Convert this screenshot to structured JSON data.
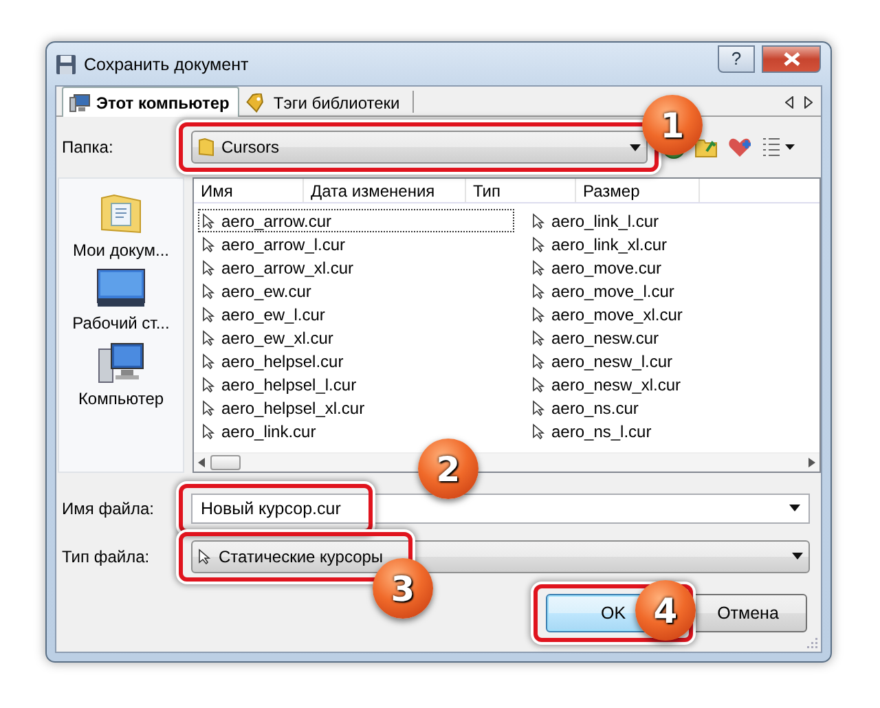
{
  "window": {
    "title": "Сохранить документ",
    "help": "?"
  },
  "tabs": [
    {
      "label": "Этот компьютер",
      "selected": true,
      "kind": "computer"
    },
    {
      "label": "Тэги библиотеки",
      "selected": false,
      "kind": "tag"
    }
  ],
  "folder": {
    "label": "Папка:",
    "value": "Cursors",
    "highlighted": true,
    "badge": "1"
  },
  "places": [
    {
      "label": "Мои докум...",
      "kind": "documents"
    },
    {
      "label": "Рабочий ст...",
      "kind": "desktop"
    },
    {
      "label": "Компьютер",
      "kind": "computer"
    }
  ],
  "columns": [
    "Имя",
    "Дата изменения",
    "Тип",
    "Размер"
  ],
  "files": [
    {
      "name": "aero_arrow.cur",
      "focused": true
    },
    {
      "name": "aero_arrow_l.cur",
      "focused": false
    },
    {
      "name": "aero_arrow_xl.cur",
      "focused": false
    },
    {
      "name": "aero_ew.cur",
      "focused": false
    },
    {
      "name": "aero_ew_l.cur",
      "focused": false
    },
    {
      "name": "aero_ew_xl.cur",
      "focused": false
    },
    {
      "name": "aero_helpsel.cur",
      "focused": false
    },
    {
      "name": "aero_helpsel_l.cur",
      "focused": false
    },
    {
      "name": "aero_helpsel_xl.cur",
      "focused": false
    },
    {
      "name": "aero_link.cur",
      "focused": false
    },
    {
      "name": "aero_link_l.cur",
      "focused": false
    },
    {
      "name": "aero_link_xl.cur",
      "focused": false
    },
    {
      "name": "aero_move.cur",
      "focused": false
    },
    {
      "name": "aero_move_l.cur",
      "focused": false
    },
    {
      "name": "aero_move_xl.cur",
      "focused": false
    },
    {
      "name": "aero_nesw.cur",
      "focused": false
    },
    {
      "name": "aero_nesw_l.cur",
      "focused": false
    },
    {
      "name": "aero_nesw_xl.cur",
      "focused": false
    },
    {
      "name": "aero_ns.cur",
      "focused": false
    },
    {
      "name": "aero_ns_l.cur",
      "focused": false
    }
  ],
  "file_name": {
    "label": "Имя файла:",
    "value": "Новый курсор.cur",
    "highlighted": true,
    "badge": "2"
  },
  "file_type": {
    "label": "Тип файла:",
    "value": "Статические курсоры",
    "highlighted": true,
    "badge": "3"
  },
  "buttons": [
    {
      "label": "OK",
      "default": true,
      "highlighted": true,
      "badge": "4"
    },
    {
      "label": "Отмена",
      "default": false,
      "highlighted": false
    }
  ]
}
